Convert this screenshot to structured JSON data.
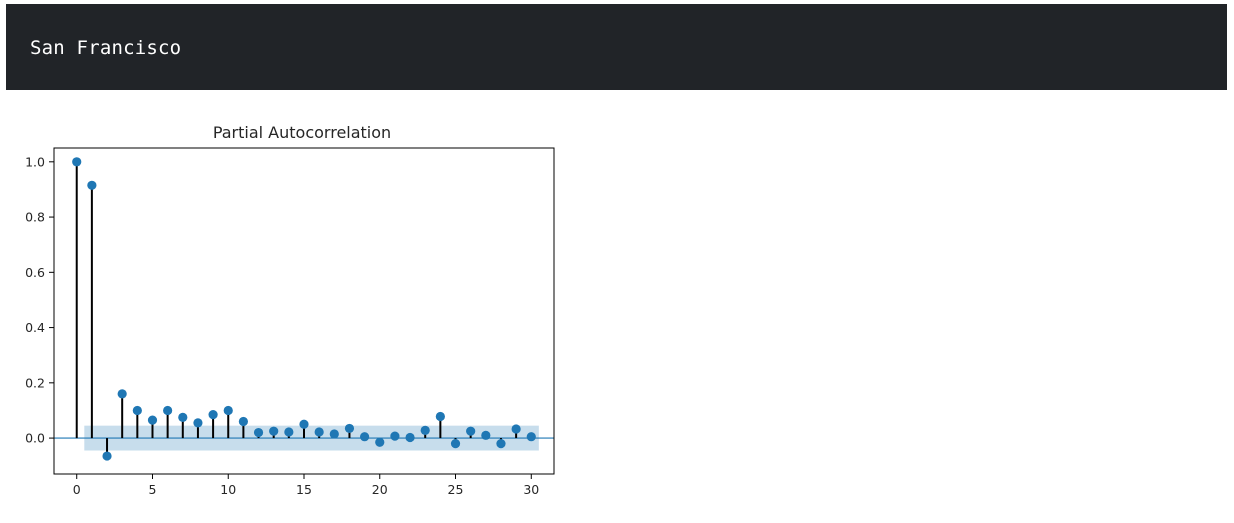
{
  "header": {
    "title": "San Francisco"
  },
  "chart_data": {
    "type": "stem",
    "title": "Partial Autocorrelation",
    "xlabel": "",
    "ylabel": "",
    "xlim": [
      -1.5,
      31.5
    ],
    "ylim": [
      -0.13,
      1.05
    ],
    "x_ticks": [
      0,
      5,
      10,
      15,
      20,
      25,
      30
    ],
    "y_ticks": [
      0.0,
      0.2,
      0.4,
      0.6,
      0.8,
      1.0
    ],
    "x_tick_labels": [
      "0",
      "5",
      "10",
      "15",
      "20",
      "25",
      "30"
    ],
    "y_tick_labels": [
      "0.0",
      "0.2",
      "0.4",
      "0.6",
      "0.8",
      "1.0"
    ],
    "grid": false,
    "lags": [
      0,
      1,
      2,
      3,
      4,
      5,
      6,
      7,
      8,
      9,
      10,
      11,
      12,
      13,
      14,
      15,
      16,
      17,
      18,
      19,
      20,
      21,
      22,
      23,
      24,
      25,
      26,
      27,
      28,
      29,
      30
    ],
    "values": [
      1.0,
      0.915,
      -0.065,
      0.16,
      0.1,
      0.065,
      0.1,
      0.075,
      0.055,
      0.085,
      0.1,
      0.06,
      0.02,
      0.025,
      0.022,
      0.05,
      0.022,
      0.015,
      0.035,
      0.005,
      -0.015,
      0.007,
      0.002,
      0.028,
      0.078,
      -0.02,
      0.025,
      0.01,
      -0.02,
      0.033,
      0.005
    ],
    "confidence_band": {
      "from_lag": 1,
      "to_lag": 30,
      "upper": 0.045,
      "lower": -0.045
    },
    "colors": {
      "marker": "#1f77b4",
      "stem": "#000000",
      "band": "#1f77b4",
      "zero_line": "#1f77b4"
    }
  }
}
